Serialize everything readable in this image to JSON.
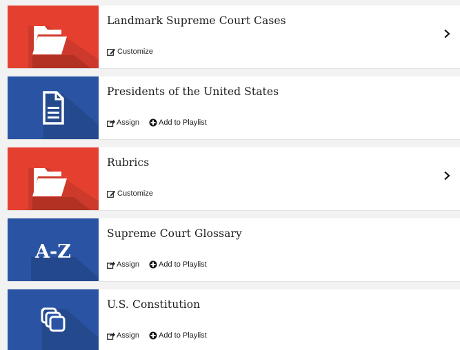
{
  "colors": {
    "folder_tile": "#e5402f",
    "resource_tile": "#2a54a3",
    "row_background": "#ffffff",
    "page_background": "#f2f2f2"
  },
  "actions": {
    "customize_label": "Customize",
    "assign_label": "Assign",
    "add_to_playlist_label": "Add to Playlist"
  },
  "items": [
    {
      "title": "Landmark Supreme Court Cases",
      "kind": "folder",
      "icon": "folder-open-icon",
      "tile_color": "#e5402f",
      "actions": [
        "Customize"
      ],
      "has_chevron": true
    },
    {
      "title": "Presidents of the United States",
      "kind": "document",
      "icon": "document-icon",
      "tile_color": "#2a54a3",
      "actions": [
        "Assign",
        "Add to Playlist"
      ],
      "has_chevron": false
    },
    {
      "title": "Rubrics",
      "kind": "folder",
      "icon": "folder-open-icon",
      "tile_color": "#e5402f",
      "actions": [
        "Customize"
      ],
      "has_chevron": true
    },
    {
      "title": "Supreme Court Glossary",
      "kind": "glossary",
      "icon": "a-z-icon",
      "icon_text": "A-Z",
      "tile_color": "#2a54a3",
      "actions": [
        "Assign",
        "Add to Playlist"
      ],
      "has_chevron": false
    },
    {
      "title": "U.S. Constitution",
      "kind": "collection",
      "icon": "stacked-pages-icon",
      "tile_color": "#2a54a3",
      "actions": [
        "Assign",
        "Add to Playlist"
      ],
      "has_chevron": false
    }
  ]
}
